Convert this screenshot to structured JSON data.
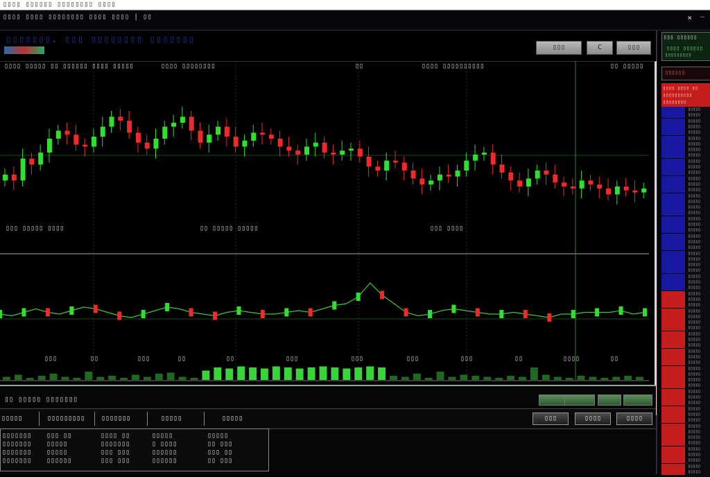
{
  "window": {
    "title": "▯▯▯▯ ▯▯▯▯▯▯ ▯▯▯▯▯▯▯▯ ▯▯▯▯",
    "menu": "▯▯▯▯ ▯▯▯▯ ▯▯▯▯▯▯▯▯ ▯▯▯▯ ▯▯▯▯ | ▯▯",
    "close": "×",
    "min": "—"
  },
  "chart_header": {
    "title": "▯▯▯▯▯▯▯. ▯▯▯ ▯▯▯▯▯▯▯▯ ▯▯▯▯▯▯▯",
    "btn1": "▯▯▯",
    "btn2": "C",
    "btn3": "▯▯▯",
    "label1": "▯▯▯▯ ▯▯▯▯▯ ▯▯ ▯▯▯▯▯▯ ▯▯▯▯ ▯▯▯▯▯",
    "label2": "▯▯▯▯ ▯▯▯▯▯▯▯▯",
    "label3": "▯▯",
    "label4": "▯▯▯▯ ▯▯▯▯▯▯▯▯▯▯",
    "label5": "▯▯ ▯▯▯▯▯",
    "label6": "▯▯▯ ▯▯▯▯▯ ▯▯▯▯",
    "label7": "▯▯ ▯▯▯▯▯ ▯▯▯▯▯",
    "label8": "▯▯▯ ▯▯▯▯",
    "x_ticks": [
      "▯▯▯",
      "▯▯",
      "▯▯▯",
      "▯▯",
      "▯▯",
      "▯▯▯",
      "▯▯▯",
      "▯▯▯",
      "▯▯▯",
      "▯▯",
      "▯▯▯▯",
      "▯▯"
    ]
  },
  "bottom": {
    "tab_title": "▯▯ ▯▯▯▯▯ ▯▯▯▯▯▯▯",
    "headers": [
      "▯▯▯▯▯",
      "▯▯▯▯▯▯▯▯▯",
      "▯▯▯▯▯▯▯",
      "▯▯▯▯▯",
      "▯▯▯▯▯"
    ],
    "btn_a": "▯▯▯",
    "btn_b": "▯▯▯▯",
    "btn_c": "▯▯▯▯",
    "rows": [
      [
        "▯▯▯▯▯▯▯",
        "▯▯▯ ▯▯",
        "▯▯▯▯ ▯▯",
        "▯▯▯▯▯",
        "▯▯▯▯▯"
      ],
      [
        "▯▯▯▯▯▯▯",
        "▯▯▯▯▯",
        "▯▯▯▯▯▯▯",
        "▯ ▯▯▯▯",
        "▯▯ ▯▯▯"
      ],
      [
        "▯▯▯▯▯▯▯",
        "▯▯▯▯▯",
        "▯▯▯ ▯▯▯",
        "▯▯▯▯▯▯",
        "▯▯▯ ▯▯"
      ],
      [
        "▯▯▯▯▯▯▯",
        "▯▯▯▯▯▯",
        "▯▯▯ ▯▯▯",
        "▯▯▯▯▯▯",
        "▯▯ ▯▯▯"
      ]
    ]
  },
  "right_panel": {
    "box_title": "▯▯▯ ▯▯▯▯▯▯",
    "box_line1": "▯▯▯▯ ▯▯▯▯▯▯",
    "box_line2": "▯▯▯▯▯▯▯▯▯",
    "small": "▯▯▯▯▯▯",
    "head1": "▯▯▯▯ ▯▯▯▯ ▯▯",
    "head2": "▯▯▯▯▯▯▯▯▯▯",
    "head3": "▯▯▯▯▯▯▯▯"
  },
  "colors": {
    "up": "#2fe02f",
    "down": "#ee2a2a",
    "bg": "#000000",
    "accent_blue": "#1e2f9a",
    "panel_blue": "#1818a0",
    "panel_red": "#c51c1c"
  },
  "chart_data": [
    {
      "type": "candlestick",
      "closes": [
        50,
        47,
        58,
        55,
        61,
        68,
        72,
        70,
        65,
        64,
        69,
        74,
        79,
        77,
        71,
        66,
        63,
        68,
        74,
        76,
        79,
        72,
        66,
        70,
        74,
        69,
        64,
        67,
        71,
        70,
        68,
        64,
        62,
        60,
        64,
        66,
        61,
        60,
        62,
        63,
        59,
        54,
        52,
        57,
        56,
        52,
        48,
        45,
        47,
        50,
        49,
        52,
        57,
        60,
        61,
        55,
        51,
        47,
        44,
        48,
        52,
        50,
        46,
        44,
        43,
        47,
        45,
        43,
        40,
        44,
        42,
        41,
        43
      ],
      "ylim": [
        20,
        100
      ]
    },
    {
      "type": "line",
      "values": [
        30,
        29,
        31,
        33,
        31,
        30,
        32,
        34,
        33,
        31,
        29,
        28,
        30,
        32,
        34,
        33,
        31,
        30,
        29,
        31,
        32,
        31,
        30,
        30,
        31,
        32,
        31,
        33,
        35,
        36,
        40,
        48,
        41,
        36,
        31,
        29,
        30,
        32,
        33,
        32,
        31,
        30,
        30,
        31,
        30,
        29,
        28,
        30,
        30,
        31,
        31,
        31,
        32,
        30,
        31
      ],
      "ylim": [
        0,
        60
      ]
    },
    {
      "type": "bar",
      "values": [
        3,
        5,
        2,
        4,
        6,
        3,
        2,
        8,
        3,
        4,
        2,
        5,
        3,
        6,
        7,
        3,
        2,
        9,
        12,
        11,
        13,
        12,
        11,
        13,
        12,
        11,
        12,
        13,
        12,
        11,
        12,
        13,
        12,
        4,
        3,
        6,
        2,
        8,
        3,
        5,
        4,
        3,
        2,
        4,
        3,
        12,
        5,
        3,
        2,
        4,
        3,
        2,
        3,
        4,
        3
      ],
      "ylim": [
        0,
        40
      ]
    }
  ]
}
